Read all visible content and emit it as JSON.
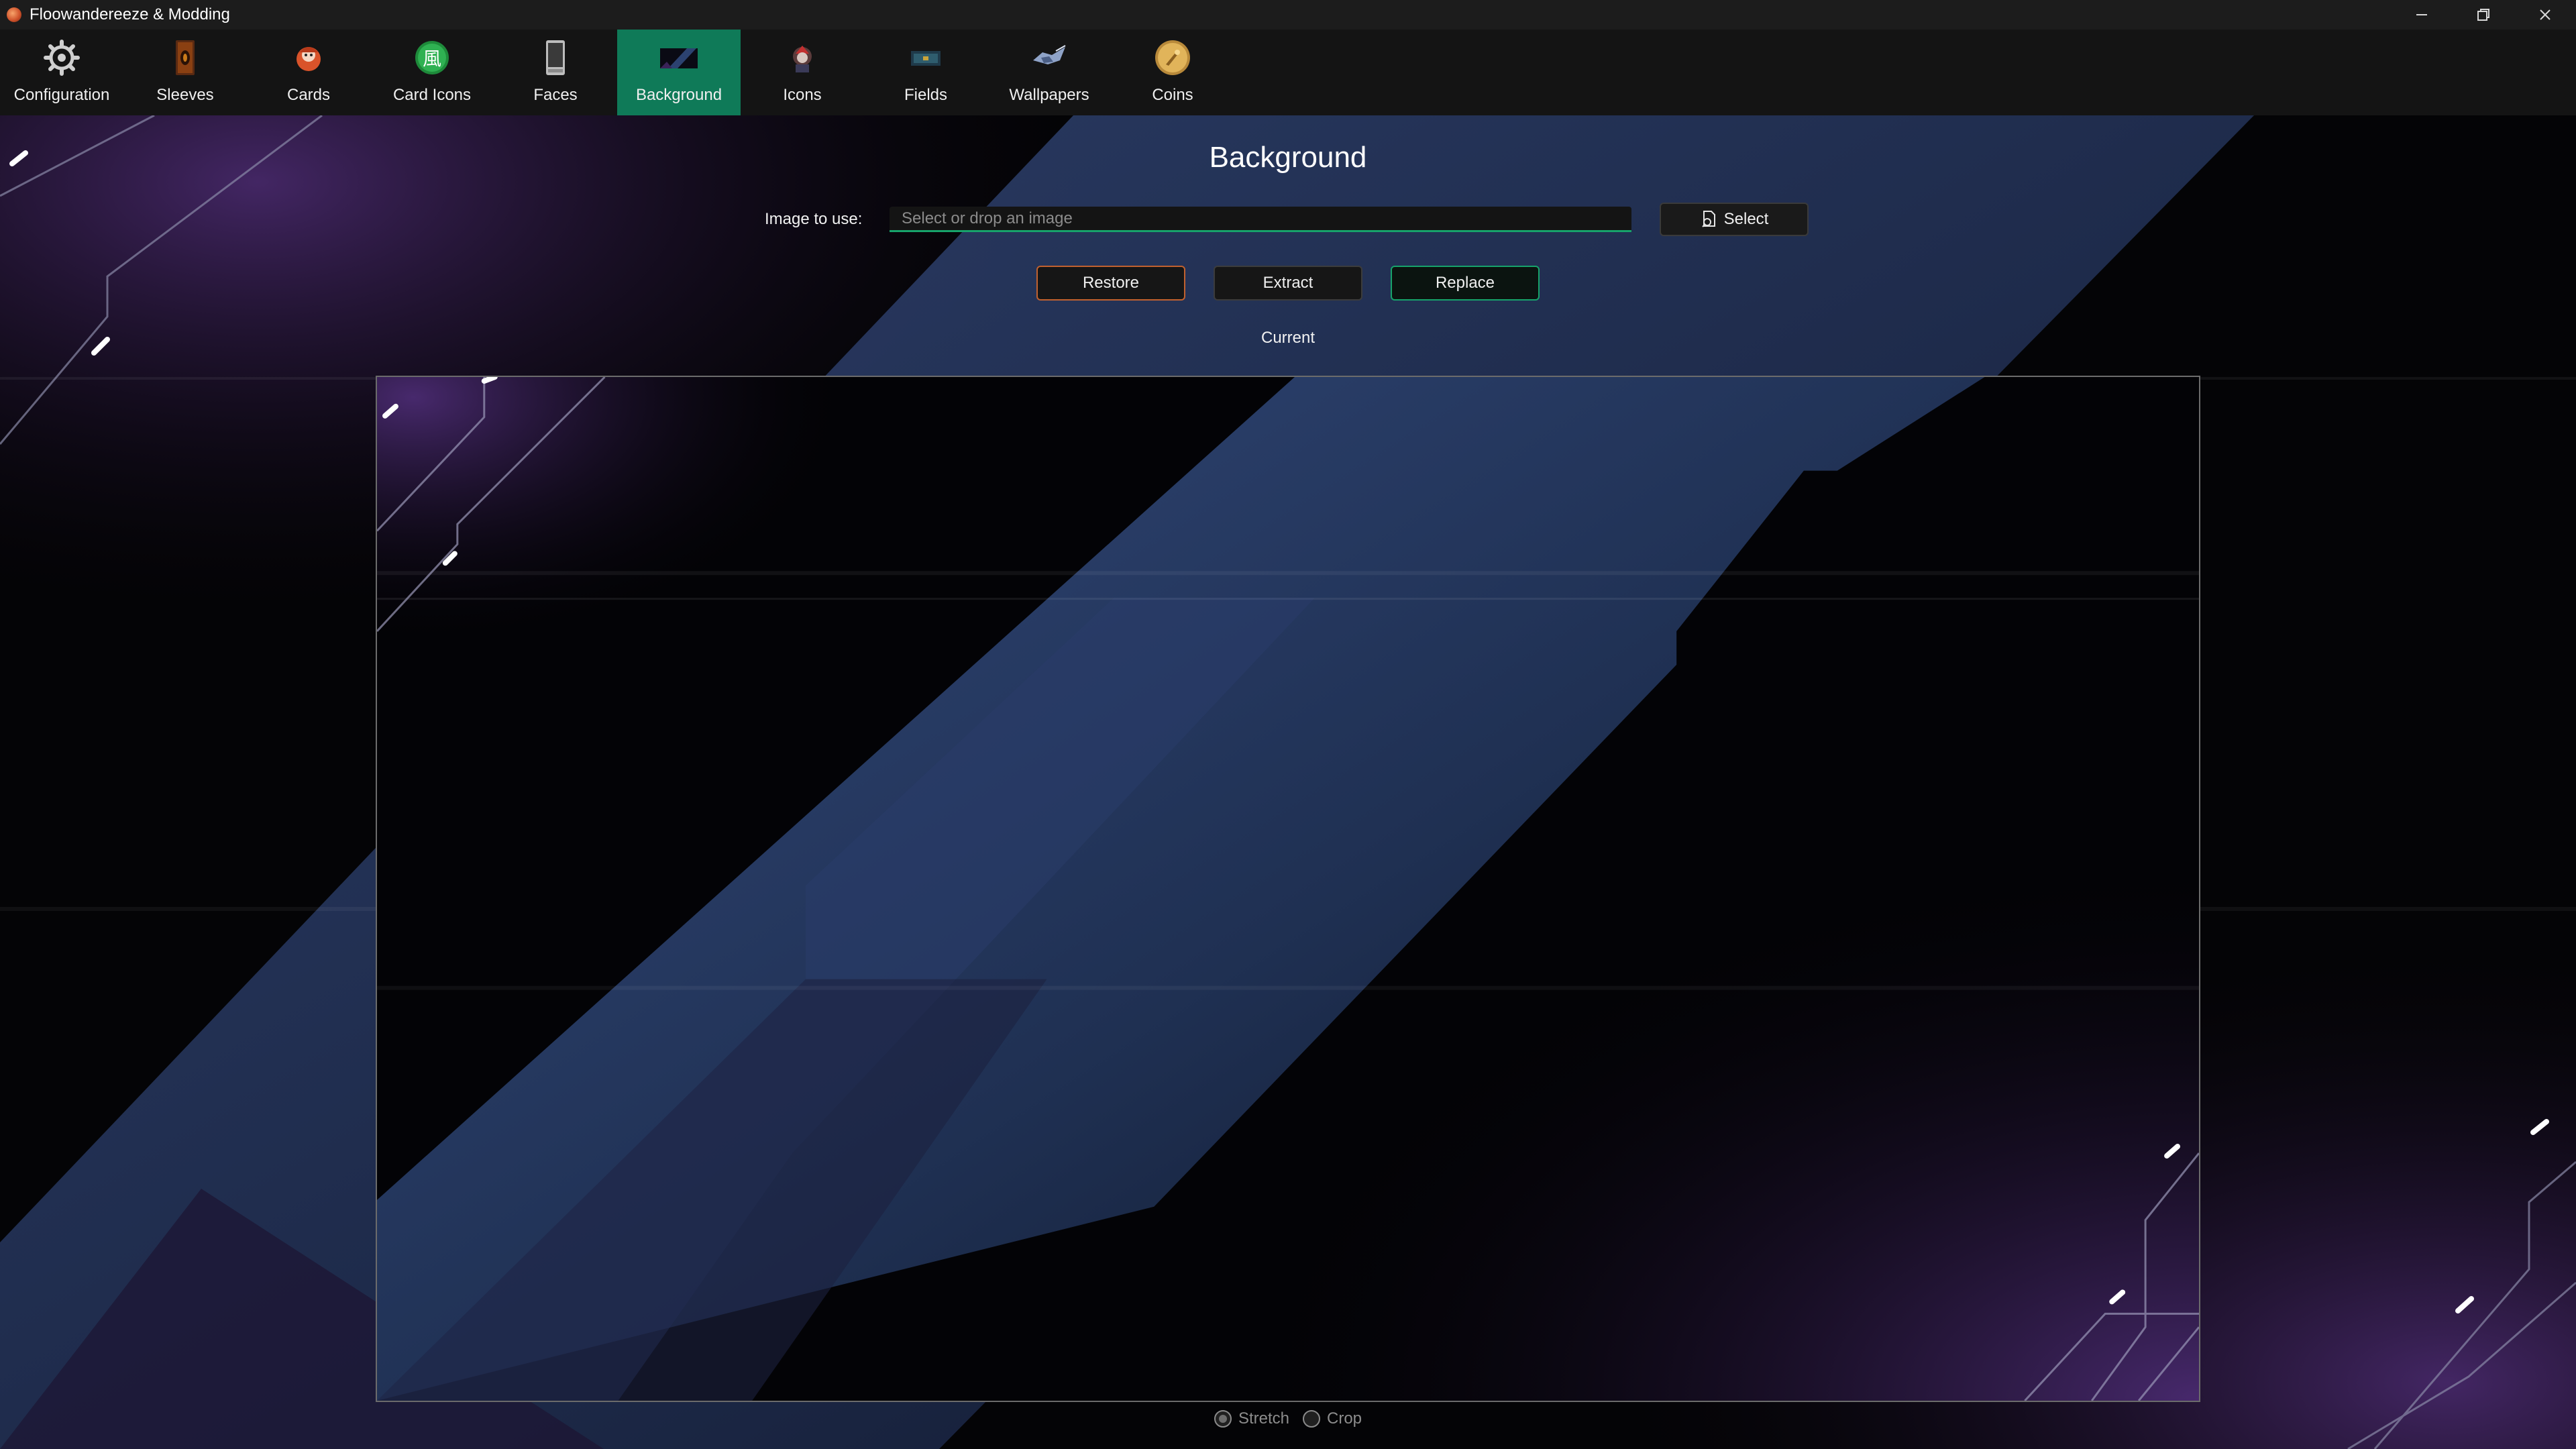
{
  "window": {
    "title": "Floowandereeze & Modding",
    "controls": [
      {
        "name": "minimize",
        "icon": "minimize-icon"
      },
      {
        "name": "restore",
        "icon": "restore-window-icon"
      },
      {
        "name": "close",
        "icon": "close-icon"
      }
    ]
  },
  "toolbar": {
    "active_tab": "Background",
    "tabs": [
      {
        "label": "Configuration",
        "icon": "gear-icon"
      },
      {
        "label": "Sleeves",
        "icon": "card-sleeve-icon"
      },
      {
        "label": "Cards",
        "icon": "card-art-icon"
      },
      {
        "label": "Card Icons",
        "icon": "wind-attribute-icon"
      },
      {
        "label": "Faces",
        "icon": "card-face-icon"
      },
      {
        "label": "Background",
        "icon": "background-icon"
      },
      {
        "label": "Icons",
        "icon": "avatar-icon"
      },
      {
        "label": "Fields",
        "icon": "field-icon"
      },
      {
        "label": "Wallpapers",
        "icon": "wallpaper-icon"
      },
      {
        "label": "Coins",
        "icon": "coin-icon"
      }
    ]
  },
  "main": {
    "title": "Background",
    "image_label": "Image to use:",
    "image_input": {
      "value": "",
      "placeholder": "Select or drop an image"
    },
    "select_button": {
      "label": "Select",
      "icon": "file-search-icon"
    },
    "actions": {
      "restore": "Restore",
      "extract": "Extract",
      "replace": "Replace"
    },
    "current_label": "Current",
    "fit_mode": {
      "selected": "Stretch",
      "options": [
        "Stretch",
        "Crop"
      ]
    }
  },
  "colors": {
    "accent_green": "#0f7a58",
    "input_underline": "#17a36b",
    "restore_border": "#c1612f",
    "diagonal_band": "#2f4576",
    "purple_glow": "#4a2a6e"
  }
}
